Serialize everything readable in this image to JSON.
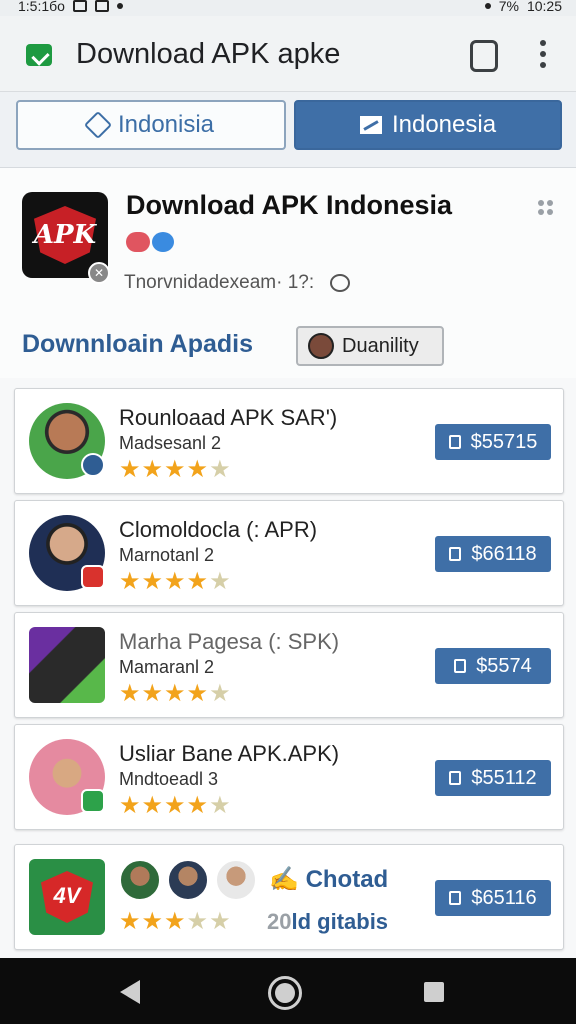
{
  "status_bar": {
    "time_left": "1:5:1бо",
    "time_right": "10:25",
    "battery": "7%"
  },
  "app_bar": {
    "title": "Download APK apke"
  },
  "lang_row": {
    "left_label": "Indonisia",
    "right_label": "Indonesia"
  },
  "hero": {
    "logo_text": "APK",
    "title": "Download APK Indonesia",
    "subtitle": "Tnorvnidadexeam· 1?:",
    "section_title": "Downnloain Apadis",
    "quality_label": "Duanility"
  },
  "items": [
    {
      "name": "Rounloaad APK SAR')",
      "sub": "Madsesanl 2",
      "rating": 4.5,
      "price": "$55715"
    },
    {
      "name": "Clomoldocla (: APR)",
      "sub": "Marnotanl 2",
      "rating": 4,
      "price": "$66118"
    },
    {
      "name": "Marha Pagesa (: SPK)",
      "sub": "Mamaranl 2",
      "rating": 3.5,
      "price": "$5574"
    },
    {
      "name": "Usliar Bane APK.APK)",
      "sub": "Mndtoeadl 3",
      "rating": 4.5,
      "price": "$55112"
    }
  ],
  "last_card": {
    "logo_text": "4V",
    "chotad": "Chotad",
    "gitabis_num": "20",
    "gitabis_text": "ld gitabis",
    "rating": 3,
    "price": "$65116"
  },
  "colors": {
    "accent": "#3f6fa7",
    "star": "#f2a31b",
    "brand_red": "#c72026",
    "green": "#1e9a41"
  }
}
